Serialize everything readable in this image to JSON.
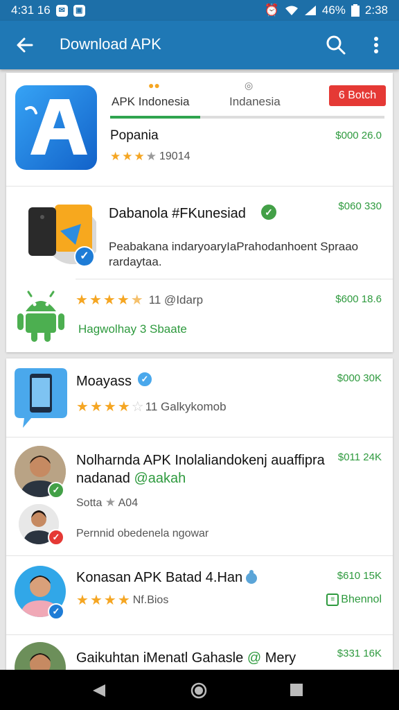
{
  "status_bar": {
    "time_left": "4:31 16",
    "battery": "46%",
    "time_right": "2:38"
  },
  "app_bar": {
    "title": "Download APK"
  },
  "featured": {
    "tab_left": "APK Indonesia",
    "tab_right": "Indanesia",
    "button_label": "6 Botch",
    "name": "Popania",
    "rating": "19014",
    "price": "$000 26.0"
  },
  "items": [
    {
      "name": "Dabanola #FKunesiad",
      "price": "$060 330",
      "description": "Peabakana indaryoaryIaPrahodanhoent Spraao rardaytaa."
    },
    {
      "rating_text": "11 @Idarp",
      "subtitle": "Hagwolhay 3 Sbaate",
      "price": "$600 18.6"
    },
    {
      "name": "Moayass",
      "rating_text": "11 Galkykomob",
      "price": "$000 30K"
    },
    {
      "name_line1": "Nolharnda APK Inolaliandokenj auaffipra",
      "name_line2": "nadanad",
      "name_tag": "@aakah",
      "price": "$011 24K",
      "rating_text": "Sotta",
      "rating_score": "A04",
      "subtitle": "Pernnid obedenela ngowar"
    },
    {
      "name": "Konasan APK Batad 4.Han",
      "rating_text": "Nf.Bios",
      "price": "$610 15K",
      "badge": "Bhennol"
    },
    {
      "name": "Gaikuhtan iMenatl Gahasle",
      "name_tag": "@",
      "name_tail": "Mery",
      "price": "$331 16K"
    }
  ],
  "colors": {
    "app_bar": "#1f78b5",
    "status_bar": "#1d6fa8",
    "price_green": "#2e9a3e",
    "star": "#f5a623",
    "button_red": "#e53935"
  }
}
